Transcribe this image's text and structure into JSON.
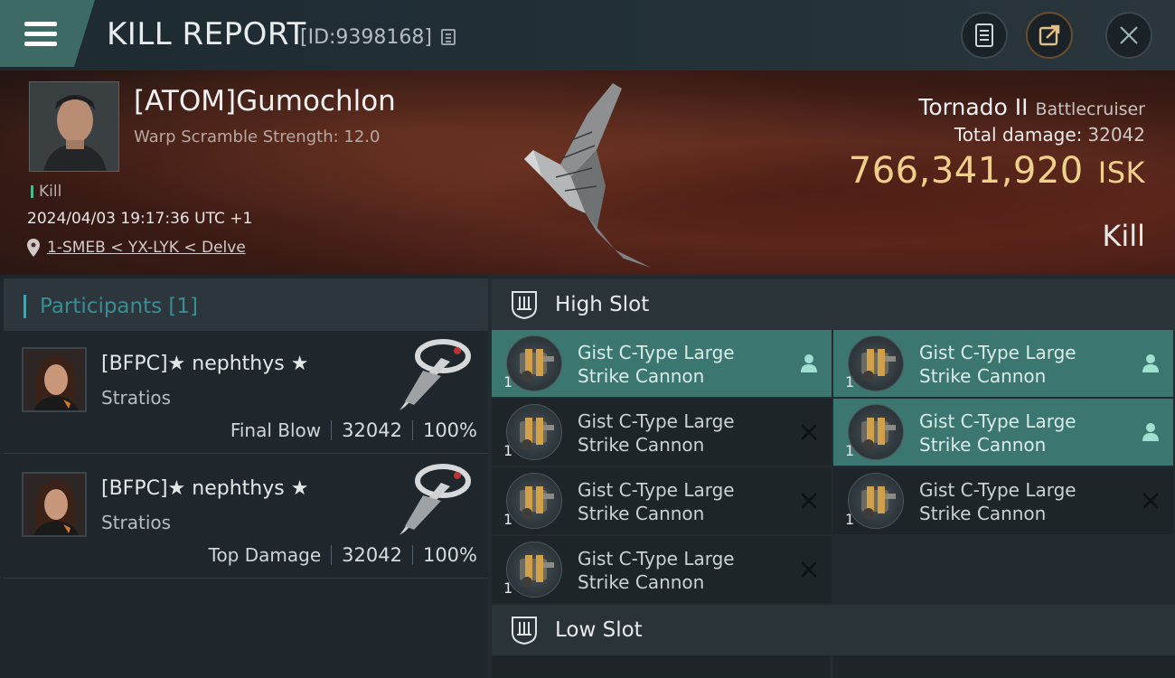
{
  "header": {
    "title": "KILL REPORT",
    "report_id": "[ID:9398168]"
  },
  "victim": {
    "name": "[ATOM]Gumochlon",
    "scramble": "Warp Scramble Strength: 12.0",
    "kill_tag": "Kill",
    "timestamp": "2024/04/03 19:17:36 UTC +1",
    "location": "1-SMEB < YX-LYK < Delve",
    "ship_name": "Tornado II",
    "ship_class": "Battlecruiser",
    "total_damage_label": "Total damage:",
    "total_damage": "32042",
    "isk_value": "766,341,920",
    "isk_unit": "ISK",
    "result": "Kill"
  },
  "participants": {
    "label": "Participants [1]",
    "rows": [
      {
        "name": "[BFPC]★ nephthys ★",
        "ship": "Stratios",
        "role": "Final Blow",
        "damage": "32042",
        "percent": "100%"
      },
      {
        "name": "[BFPC]★ nephthys ★",
        "ship": "Stratios",
        "role": "Top Damage",
        "damage": "32042",
        "percent": "100%"
      }
    ]
  },
  "fittings": {
    "high_slot_label": "High Slot",
    "low_slot_label": "Low Slot",
    "high_modules": [
      {
        "line1": "Gist C-Type Large",
        "line2": "Strike Cannon",
        "qty": "1",
        "status": "pilot-icon",
        "active": true
      },
      {
        "line1": "Gist C-Type Large",
        "line2": "Strike Cannon",
        "qty": "1",
        "status": "pilot-icon",
        "active": true
      },
      {
        "line1": "Gist C-Type Large",
        "line2": "Strike Cannon",
        "qty": "1",
        "status": "destroyed-icon",
        "active": false
      },
      {
        "line1": "Gist C-Type Large",
        "line2": "Strike Cannon",
        "qty": "1",
        "status": "pilot-icon",
        "active": true
      },
      {
        "line1": "Gist C-Type Large",
        "line2": "Strike Cannon",
        "qty": "1",
        "status": "destroyed-icon",
        "active": false
      },
      {
        "line1": "Gist C-Type Large",
        "line2": "Strike Cannon",
        "qty": "1",
        "status": "destroyed-icon",
        "active": false
      },
      {
        "line1": "Gist C-Type Large",
        "line2": "Strike Cannon",
        "qty": "1",
        "status": "destroyed-icon",
        "active": false
      }
    ]
  },
  "colors": {
    "accent_teal": "#3c7670",
    "isk_gold": "#f0cf8a",
    "kill_green": "#4cb88f"
  }
}
